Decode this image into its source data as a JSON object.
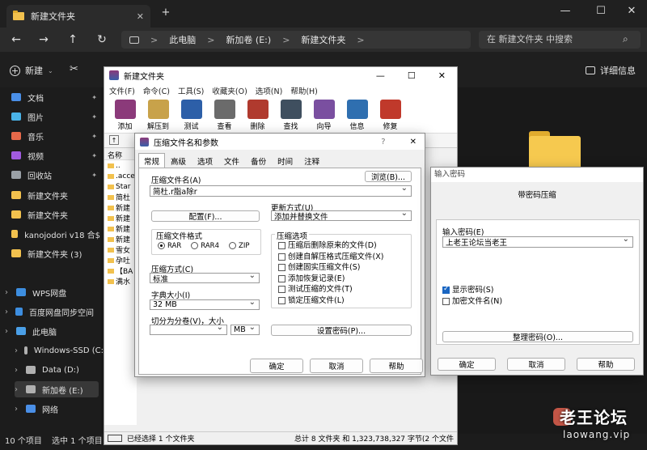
{
  "explorer": {
    "tab_title": "新建文件夹",
    "new_tab": "+",
    "window_controls": [
      "—",
      "☐",
      "✕"
    ],
    "address": {
      "crumbs": [
        "此电脑",
        "新加卷 (E:)",
        "新建文件夹"
      ],
      "separator": ">"
    },
    "search_placeholder": "在 新建文件夹 中搜索",
    "toolbar": {
      "new_label": "新建",
      "details_label": "详细信息"
    },
    "sidebar": [
      {
        "label": "文档",
        "icon": "document-icon",
        "pinned": true
      },
      {
        "label": "图片",
        "icon": "picture-icon",
        "pinned": true
      },
      {
        "label": "音乐",
        "icon": "music-icon",
        "pinned": true
      },
      {
        "label": "视频",
        "icon": "video-icon",
        "pinned": true
      },
      {
        "label": "回收站",
        "icon": "recycle-bin-icon",
        "pinned": true
      },
      {
        "label": "新建文件夹",
        "icon": "folder-icon"
      },
      {
        "label": "新建文件夹",
        "icon": "folder-icon"
      },
      {
        "label": "kanojodori v18 合$",
        "icon": "folder-icon"
      },
      {
        "label": "新建文件夹 (3)",
        "icon": "folder-icon"
      },
      {
        "label": "WPS网盘",
        "icon": "cloud-icon"
      },
      {
        "label": "百度网盘同步空间",
        "icon": "cloud-icon"
      },
      {
        "label": "此电脑",
        "icon": "computer-icon"
      },
      {
        "label": "Windows-SSD (C:",
        "icon": "drive-icon"
      },
      {
        "label": "Data (D:)",
        "icon": "drive-icon"
      },
      {
        "label": "新加卷 (E:)",
        "icon": "drive-icon"
      },
      {
        "label": "网络",
        "icon": "network-icon"
      }
    ],
    "status": {
      "count": "10 个项目",
      "selected": "选中 1 个项目"
    }
  },
  "winrar": {
    "title": "新建文件夹",
    "menu": [
      "文件(F)",
      "命令(C)",
      "工具(S)",
      "收藏夹(O)",
      "选项(N)",
      "帮助(H)"
    ],
    "tools": [
      {
        "label": "添加",
        "color": "#8b3a7a"
      },
      {
        "label": "解压到",
        "color": "#c8a24a"
      },
      {
        "label": "测试",
        "color": "#2d5fa8"
      },
      {
        "label": "查看",
        "color": "#6b6b6b"
      },
      {
        "label": "删除",
        "color": "#b03a2e"
      },
      {
        "label": "查找",
        "color": "#3f4f5f"
      },
      {
        "label": "向导",
        "color": "#7a4fa0"
      },
      {
        "label": "信息",
        "color": "#2f6fb0"
      },
      {
        "label": "修复",
        "color": "#c0392b"
      }
    ],
    "list_header": "名称",
    "list": [
      "..",
      ".acce",
      "Star",
      "简杜",
      "新建",
      "新建",
      "新建",
      "新建",
      "雪女",
      "孕吐",
      "【BA",
      "满水"
    ],
    "status_left": "已经选择 1 个文件夹",
    "status_right": "总计 8 文件夹 和 1,323,738,327 字节(2 个文件"
  },
  "archive_dialog": {
    "title": "压缩文件名和参数",
    "help_mark": "?",
    "close": "✕",
    "tabs": [
      "常规",
      "高级",
      "选项",
      "文件",
      "备份",
      "时间",
      "注释"
    ],
    "archive_name_label": "压缩文件名(A)",
    "browse_label": "浏览(B)...",
    "archive_name": "简杜.r脂a除r",
    "profile_label": "配置(F)...",
    "update_mode_label": "更新方式(U)",
    "update_mode": "添加并替换文件",
    "format_group": "压缩文件格式",
    "formats": [
      {
        "label": "RAR",
        "on": true
      },
      {
        "label": "RAR4",
        "on": false
      },
      {
        "label": "ZIP",
        "on": false
      }
    ],
    "method_label": "压缩方式(C)",
    "method": "标准",
    "dict_label": "字典大小(I)",
    "dict": "32 MB",
    "split_label": "切分为分卷(V)，大小",
    "split_unit": "MB",
    "options_group": "压缩选项",
    "options": [
      {
        "label": "压缩后删除原来的文件(D)",
        "on": false
      },
      {
        "label": "创建自解压格式压缩文件(X)",
        "on": false
      },
      {
        "label": "创建固实压缩文件(S)",
        "on": false
      },
      {
        "label": "添加恢复记录(E)",
        "on": false
      },
      {
        "label": "测试压缩的文件(T)",
        "on": false
      },
      {
        "label": "锁定压缩文件(L)",
        "on": false
      }
    ],
    "set_password_label": "设置密码(P)...",
    "ok": "确定",
    "cancel": "取消",
    "help": "帮助"
  },
  "password_dialog": {
    "title": "输入密码",
    "heading": "带密码压缩",
    "password_label": "输入密码(E)",
    "password_value": "上老王论坛当老王",
    "show_password": {
      "label": "显示密码(S)",
      "on": true
    },
    "encrypt_names": {
      "label": "加密文件名(N)",
      "on": false
    },
    "organize_label": "整理密码(O)...",
    "ok": "确定",
    "cancel": "取消",
    "help": "帮助"
  },
  "watermark": {
    "name": "老王论坛",
    "url": "laowang.vip"
  }
}
